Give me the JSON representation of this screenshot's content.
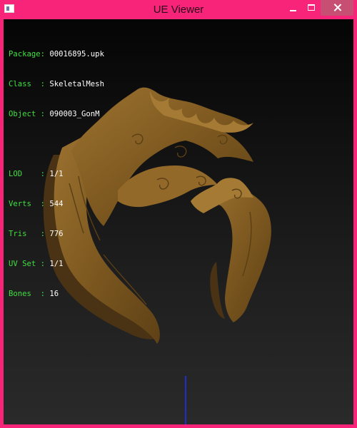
{
  "window": {
    "title": "UE Viewer",
    "accent_color": "#f7247a",
    "close_button_color": "#c74f74"
  },
  "titlebar_icons": {
    "app": "app-icon",
    "minimize": "minimize-icon",
    "maximize": "maximize-icon",
    "close": "close-icon"
  },
  "info": {
    "label_color": "#40e040",
    "value_color": "#ffffff",
    "rows": [
      {
        "label": "Package: ",
        "value": "00016895.upk"
      },
      {
        "label": "Class  : ",
        "value": "SkeletalMesh"
      },
      {
        "label": "Object : ",
        "value": "090003_GonM"
      },
      {
        "label": "LOD    : ",
        "value": "1/1"
      },
      {
        "label": "Verts  : ",
        "value": "544"
      },
      {
        "label": "Tris   : ",
        "value": "776"
      },
      {
        "label": "UV Set : ",
        "value": "1/1"
      },
      {
        "label": "Bones  : ",
        "value": "16"
      }
    ]
  },
  "viewport": {
    "mesh_color": "#8a6224",
    "axis_color": "#1e2ec8"
  }
}
